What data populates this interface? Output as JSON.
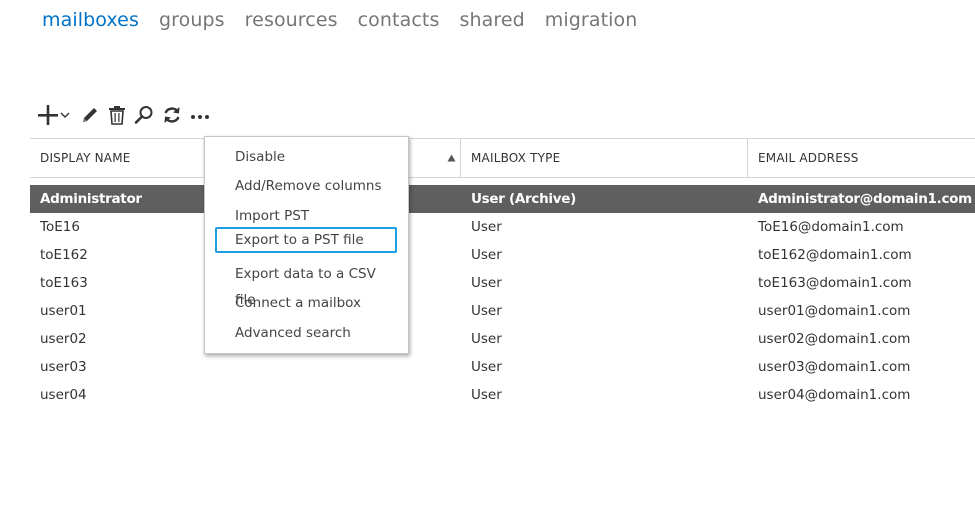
{
  "nav": {
    "tabs": [
      {
        "label": "mailboxes",
        "active": true
      },
      {
        "label": "groups"
      },
      {
        "label": "resources"
      },
      {
        "label": "contacts"
      },
      {
        "label": "shared"
      },
      {
        "label": "migration"
      }
    ]
  },
  "toolbar": {
    "icons": [
      "plus-icon",
      "dropdown-caret-icon",
      "pencil-icon",
      "trash-icon",
      "search-icon",
      "refresh-icon",
      "more-icon"
    ]
  },
  "table": {
    "columns": [
      "DISPLAY NAME",
      "MAILBOX TYPE",
      "EMAIL ADDRESS"
    ],
    "sort": "ascending",
    "rows": [
      {
        "name": "Administrator",
        "type": "User (Archive)",
        "email": "Administrator@domain1.com",
        "selected": true
      },
      {
        "name": "ToE16",
        "type": "User",
        "email": "ToE16@domain1.com"
      },
      {
        "name": "toE162",
        "type": "User",
        "email": "toE162@domain1.com"
      },
      {
        "name": "toE163",
        "type": "User",
        "email": "toE163@domain1.com"
      },
      {
        "name": "user01",
        "type": "User",
        "email": "user01@domain1.com"
      },
      {
        "name": "user02",
        "type": "User",
        "email": "user02@domain1.com"
      },
      {
        "name": "user03",
        "type": "User",
        "email": "user03@domain1.com"
      },
      {
        "name": "user04",
        "type": "User",
        "email": "user04@domain1.com"
      }
    ]
  },
  "menu": {
    "items": [
      {
        "label": "Disable"
      },
      {
        "label": "Add/Remove columns"
      },
      {
        "label": "Import PST"
      },
      {
        "label": "Export to a PST file",
        "focused": true
      },
      {
        "label": "Export data to a CSV file"
      },
      {
        "label": "Connect a mailbox"
      },
      {
        "label": "Advanced search"
      }
    ]
  },
  "colors": {
    "accent": "#0072c6",
    "selected_row": "#5f5f5f",
    "focus_border": "#1e9fe2"
  }
}
